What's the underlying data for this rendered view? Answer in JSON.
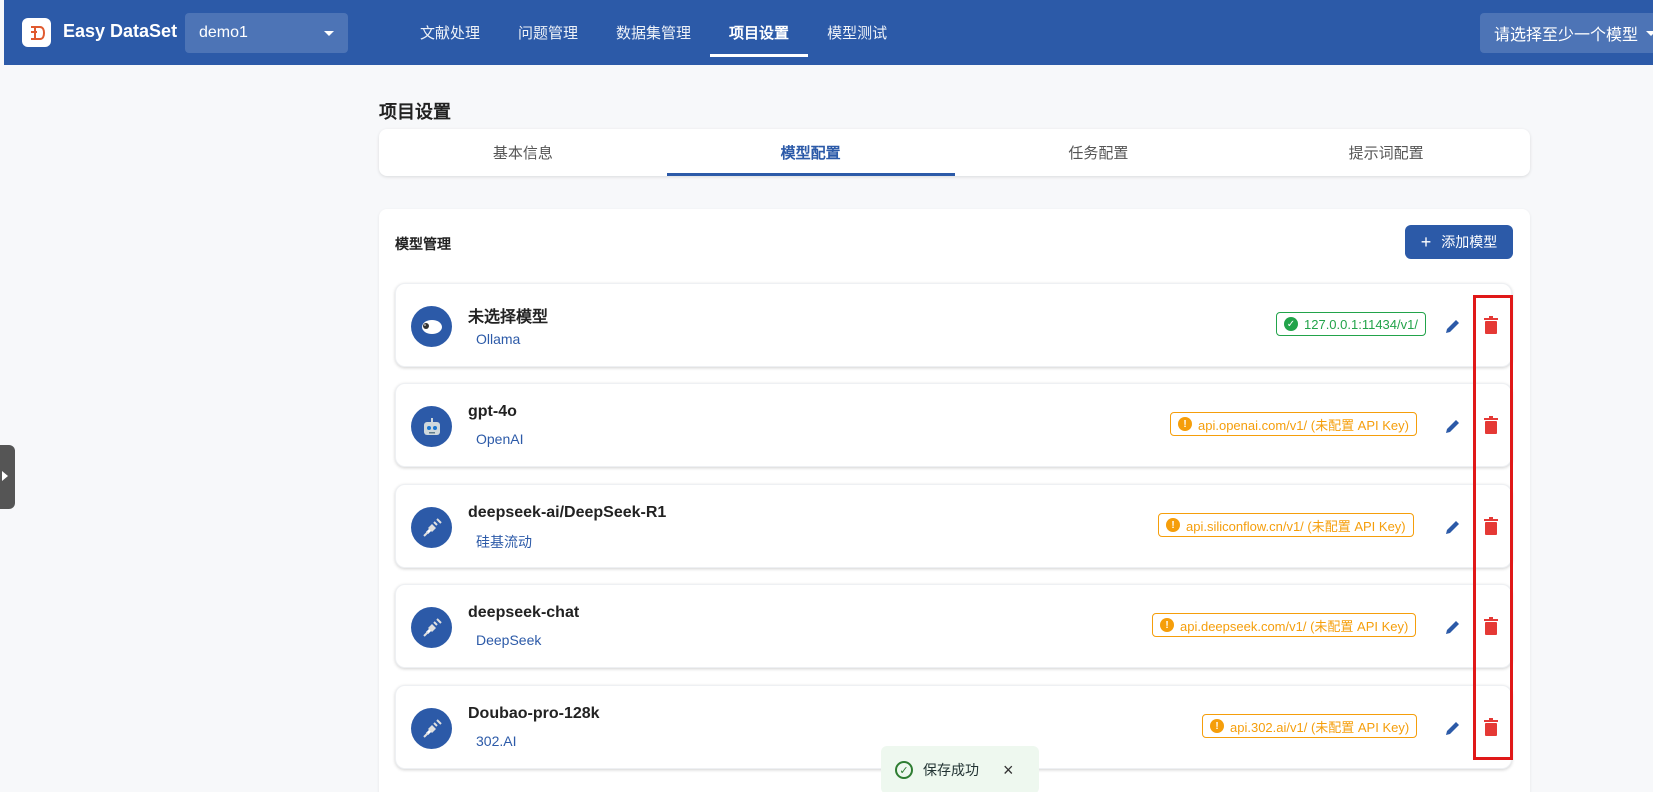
{
  "header": {
    "brand": "Easy DataSet",
    "project_select": "demo1",
    "nav_tabs": [
      {
        "label": "文献处理"
      },
      {
        "label": "问题管理"
      },
      {
        "label": "数据集管理"
      },
      {
        "label": "项目设置",
        "active": true
      },
      {
        "label": "模型测试"
      }
    ],
    "model_select_placeholder": "请选择至少一个模型"
  },
  "page": {
    "title": "项目设置",
    "tabs": [
      {
        "label": "基本信息"
      },
      {
        "label": "模型配置",
        "active": true
      },
      {
        "label": "任务配置"
      },
      {
        "label": "提示词配置"
      }
    ]
  },
  "model_management": {
    "title": "模型管理",
    "add_button": "添加模型",
    "models": [
      {
        "name": "未选择模型",
        "provider": "Ollama",
        "endpoint": "127.0.0.1:11434/v1/",
        "status": "ok",
        "avatar": "sheep-icon"
      },
      {
        "name": "gpt-4o",
        "provider": "OpenAI",
        "endpoint": "api.openai.com/v1/ (未配置 API Key)",
        "status": "warn",
        "avatar": "robot-icon"
      },
      {
        "name": "deepseek-ai/DeepSeek-R1",
        "provider": "硅基流动",
        "endpoint": "api.siliconflow.cn/v1/ (未配置 API Key)",
        "status": "warn",
        "avatar": "plug-icon"
      },
      {
        "name": "deepseek-chat",
        "provider": "DeepSeek",
        "endpoint": "api.deepseek.com/v1/ (未配置 API Key)",
        "status": "warn",
        "avatar": "plug-icon"
      },
      {
        "name": "Doubao-pro-128k",
        "provider": "302.AI",
        "endpoint": "api.302.ai/v1/ (未配置 API Key)",
        "status": "warn",
        "avatar": "plug-icon"
      }
    ]
  },
  "toast": {
    "message": "保存成功"
  },
  "colors": {
    "primary": "#2c5aa8",
    "success": "#22a34a",
    "warning": "#f59e0b",
    "danger": "#e53935",
    "highlight": "#e01818"
  }
}
